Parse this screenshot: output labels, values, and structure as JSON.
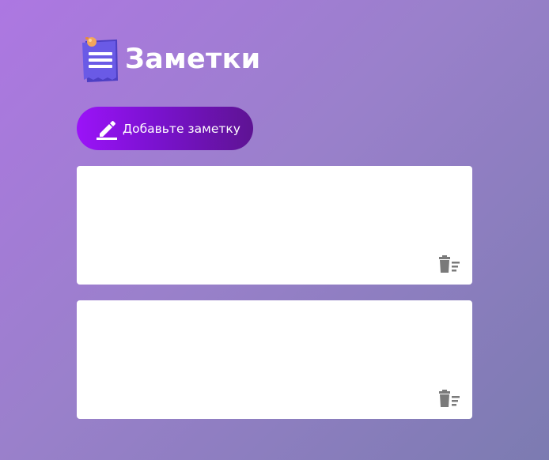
{
  "app": {
    "title": "Заметки",
    "logo_icon": "notepad-with-pin-icon"
  },
  "toolbar": {
    "add_label": "Добавьте заметку",
    "add_icon": "pencil-icon"
  },
  "notes": [
    {
      "text": "",
      "delete_icon": "trash-icon"
    },
    {
      "text": "",
      "delete_icon": "trash-icon"
    }
  ],
  "colors": {
    "background_start": "#ad77e2",
    "background_end": "#7c7bb1",
    "button_start": "#9b13f8",
    "button_end": "#5e1393",
    "note_bg": "#ffffff",
    "icon_gray": "#7a7a7a"
  }
}
